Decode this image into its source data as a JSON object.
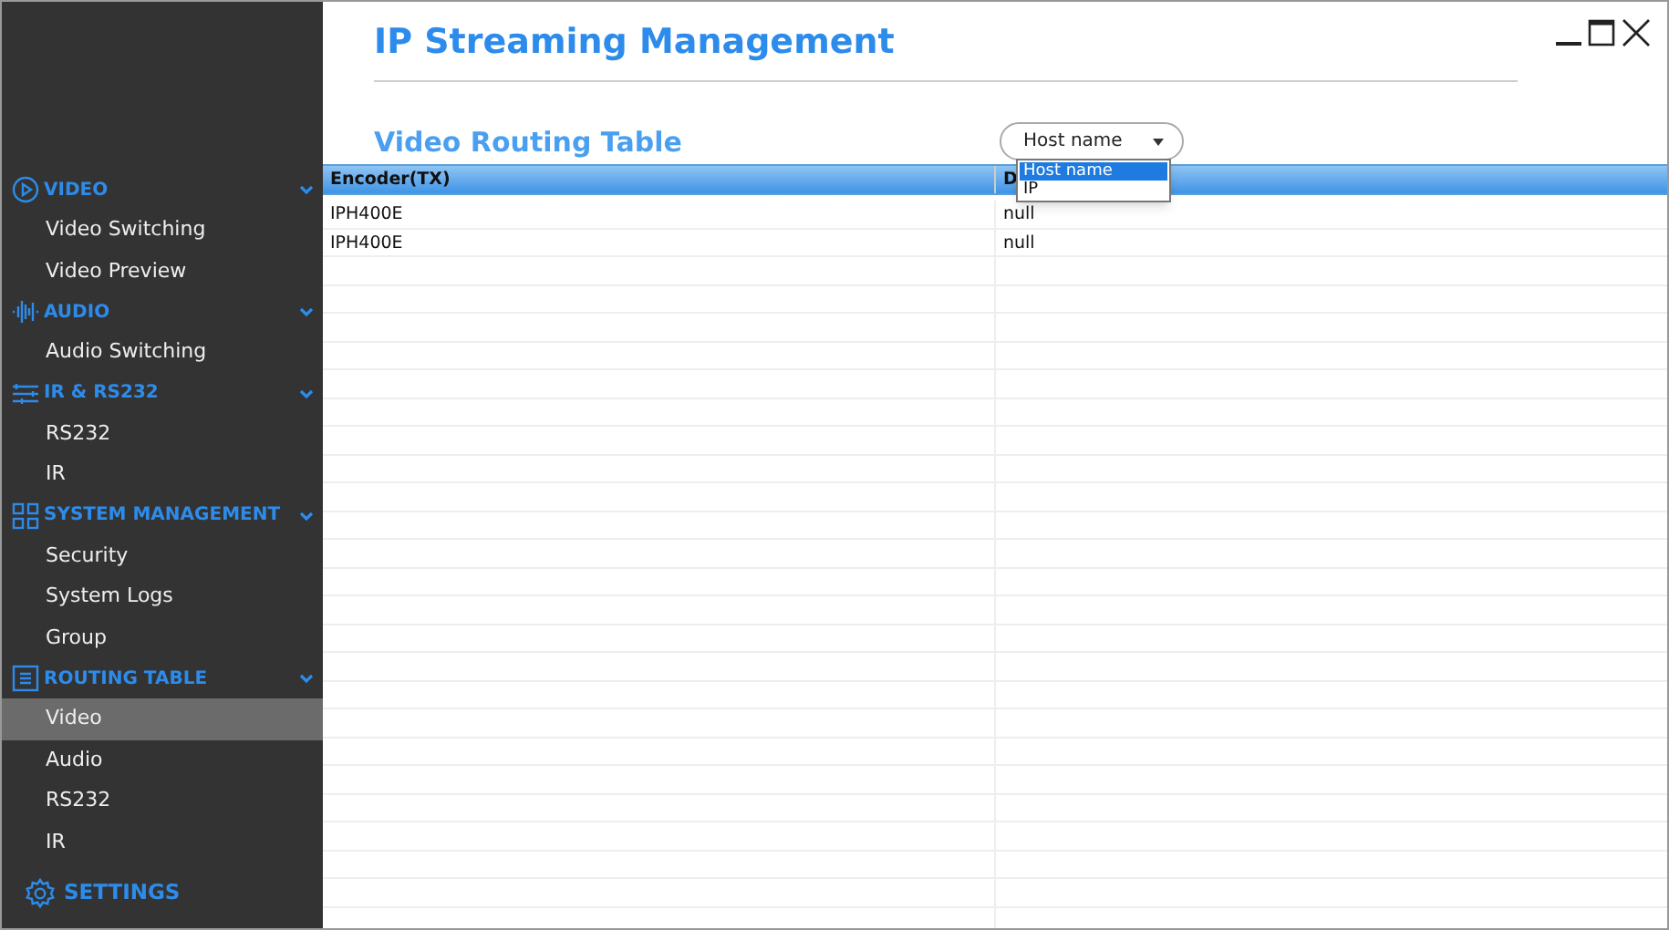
{
  "window": {
    "title": "IP Streaming Management"
  },
  "sidebar": {
    "sections": [
      {
        "kind": "video",
        "label": "VIDEO",
        "expanded": true,
        "items": [
          {
            "label": "Video Switching",
            "selected": false
          },
          {
            "label": "Video Preview",
            "selected": false
          }
        ]
      },
      {
        "kind": "audio",
        "label": "AUDIO",
        "expanded": true,
        "items": [
          {
            "label": "Audio Switching",
            "selected": false
          }
        ]
      },
      {
        "kind": "ir",
        "label": "IR & RS232",
        "expanded": true,
        "items": [
          {
            "label": "RS232",
            "selected": false
          },
          {
            "label": "IR",
            "selected": false
          }
        ]
      },
      {
        "kind": "system",
        "label": "SYSTEM MANAGEMENT",
        "expanded": true,
        "items": [
          {
            "label": "Security",
            "selected": false
          },
          {
            "label": "System Logs",
            "selected": false
          },
          {
            "label": "Group",
            "selected": false
          }
        ]
      },
      {
        "kind": "routing",
        "label": "ROUTING TABLE",
        "expanded": true,
        "items": [
          {
            "label": "Video",
            "selected": true
          },
          {
            "label": "Audio",
            "selected": false
          },
          {
            "label": "RS232",
            "selected": false
          },
          {
            "label": "IR",
            "selected": false
          }
        ]
      }
    ],
    "settings": {
      "label": "SETTINGS"
    }
  },
  "section_title": "Video Routing Table",
  "dropdown": {
    "value": "Host name",
    "expanded": true,
    "options": [
      {
        "label": "Host name",
        "selected": true
      },
      {
        "label": "IP",
        "selected": false
      }
    ]
  },
  "table": {
    "columns": [
      "Encoder(TX)",
      "D"
    ],
    "rows": [
      [
        "IPH400E",
        "null"
      ],
      [
        "IPH400E",
        "null"
      ]
    ]
  }
}
